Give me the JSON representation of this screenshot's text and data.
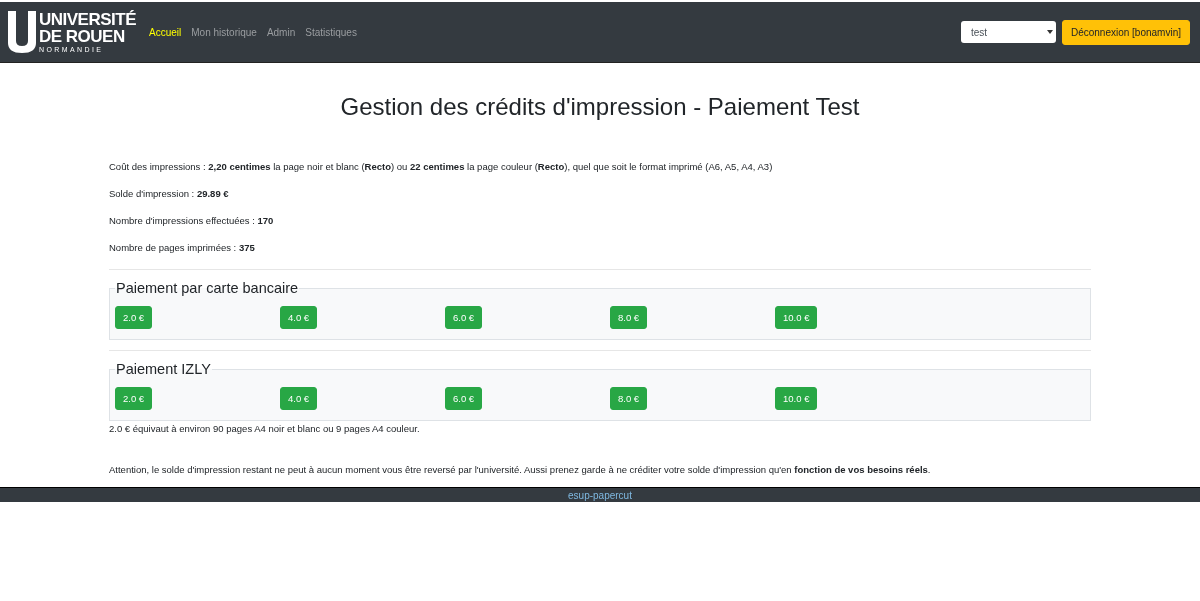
{
  "logo": {
    "line_1": "UNIVERSITÉ",
    "line_2": "DE ROUEN",
    "line_3": "NORMANDIE"
  },
  "nav": [
    {
      "label": "Accueil",
      "selected": true
    },
    {
      "label": "Mon historique",
      "selected": false
    },
    {
      "label": "Admin",
      "selected": false
    },
    {
      "label": "Statistiques",
      "selected": false
    }
  ],
  "user_select": {
    "value": "test"
  },
  "logout_button": "Déconnexion [bonamvin]",
  "title": "Gestion des crédits d'impression - Paiement Test",
  "info": [
    "Coût des impressions : **2,20 centimes** la page noir et blanc (**Recto**) ou **22 centimes** la page couleur (**Recto**), quel que soit le format imprimé (A6, A5, A4, A3)",
    "Solde d'impression : **29.89 €**",
    "Nombre d'impressions effectuées : **170**",
    "Nombre de pages imprimées : **375**"
  ],
  "payments": [
    {
      "legend": "Paiement par carte bancaire",
      "amounts": [
        "2.0 €",
        "4.0 €",
        "6.0 €",
        "8.0 €",
        "10.0 €"
      ]
    },
    {
      "legend": "Paiement IZLY",
      "amounts": [
        "2.0 €",
        "4.0 €",
        "6.0 €",
        "8.0 €",
        "10.0 €"
      ]
    }
  ],
  "equivalence_note": "2.0 € équivaut à environ 90 pages A4 noir et blanc ou 9 pages A4 couleur.",
  "warning": "Attention, le solde d'impression restant ne peut à aucun moment vous être reversé par l'université. Aussi prenez garde à ne créditer votre solde d'impression qu'en **fonction de vos besoins réels**.",
  "footer": "esup-papercut"
}
